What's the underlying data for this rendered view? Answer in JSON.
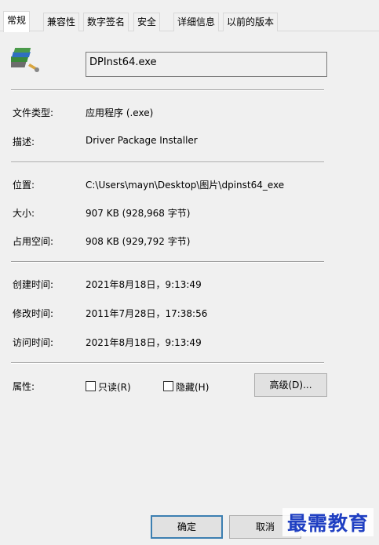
{
  "tabs": [
    {
      "label": "常规",
      "active": true
    },
    {
      "label": "兼容性"
    },
    {
      "label": "数字签名"
    },
    {
      "label": "安全"
    },
    {
      "label": "详细信息"
    },
    {
      "label": "以前的版本"
    }
  ],
  "general": {
    "file_name": "DPInst64.exe",
    "file_type": {
      "label": "文件类型:",
      "value": "应用程序 (.exe)"
    },
    "description": {
      "label": "描述:",
      "value": "Driver Package Installer"
    },
    "location": {
      "label": "位置:",
      "value": "C:\\Users\\mayn\\Desktop\\图片\\dpinst64_exe"
    },
    "size": {
      "label": "大小:",
      "value": "907 KB (928,968 字节)"
    },
    "size_on_disk": {
      "label": "占用空间:",
      "value": "908 KB (929,792 字节)"
    },
    "created": {
      "label": "创建时间:",
      "value": "2021年8月18日，9:13:49"
    },
    "modified": {
      "label": "修改时间:",
      "value": "2011年7月28日，17:38:56"
    },
    "accessed": {
      "label": "访问时间:",
      "value": "2021年8月18日，9:13:49"
    },
    "attributes": {
      "label": "属性:",
      "readonly_label": "只读(R)",
      "hidden_label": "隐藏(H)",
      "advanced_label": "高级(D)..."
    }
  },
  "footer": {
    "ok_label": "确定",
    "cancel_label": "取消"
  },
  "watermark": "最需教育",
  "colors": {
    "accent": "#3c7fb1",
    "watermark": "#1f3fc2"
  }
}
